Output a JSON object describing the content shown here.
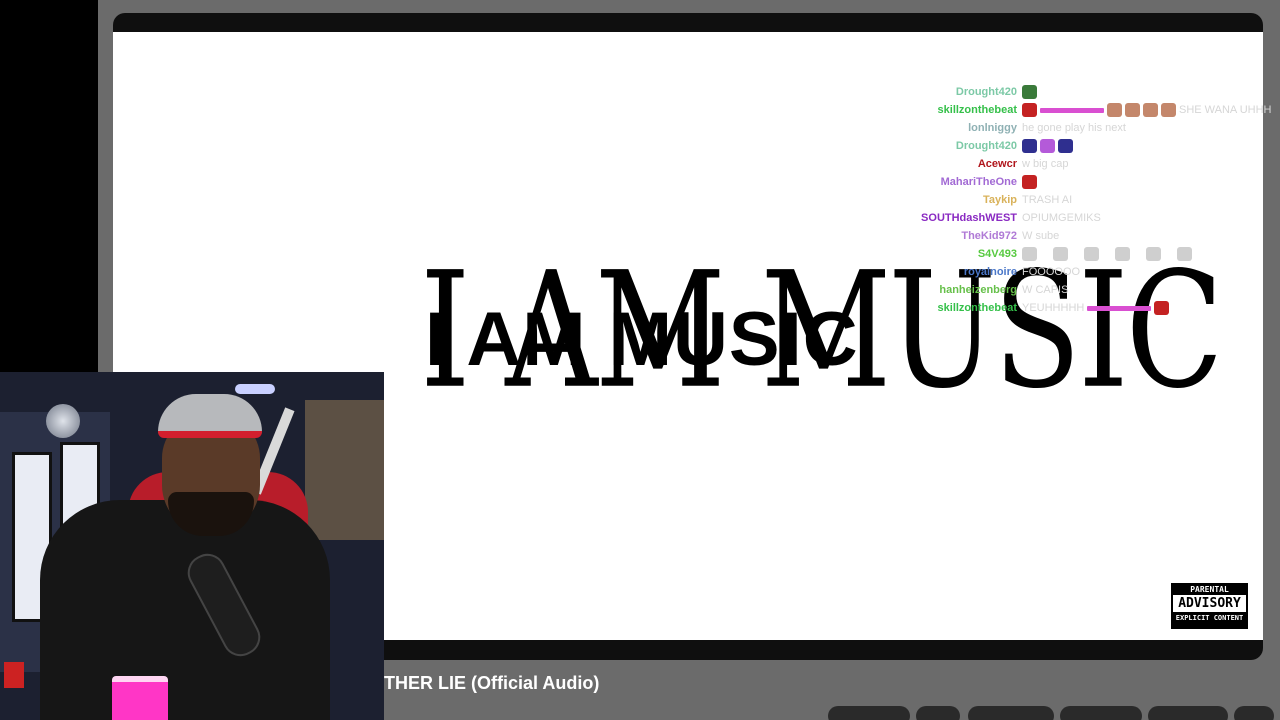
{
  "video": {
    "title_line_serif": "I AM MUSIC",
    "title_line_sans": "I AM MUSIC",
    "title": "THER LIE (Official Audio)"
  },
  "advisory": {
    "top": "PARENTAL",
    "mid": "ADVISORY",
    "bottom": "EXPLICIT CONTENT"
  },
  "chat": {
    "messages": [
      {
        "user": "Drought420",
        "color": "#7cc9a6",
        "text": ""
      },
      {
        "user": "skillzonthebeat",
        "color": "#35c04a",
        "text": "SHE WANA UHHH"
      },
      {
        "user": "lonlniggy",
        "color": "#8fb1b4",
        "text": "he gone play his next"
      },
      {
        "user": "Drought420",
        "color": "#7cc9a6",
        "text": ""
      },
      {
        "user": "Acewcr",
        "color": "#b0161c",
        "text": "w big cap"
      },
      {
        "user": "MahariTheOne",
        "color": "#a26ad4",
        "text": ""
      },
      {
        "user": "Taykip",
        "color": "#d9b25a",
        "text": "TRASH AI"
      },
      {
        "user": "SOUTHdashWEST",
        "color": "#8a2ac2",
        "text": "OPIUMGEMIKS"
      },
      {
        "user": "TheKid972",
        "color": "#b07ad6",
        "text": "W sube"
      },
      {
        "user": "S4V493",
        "color": "#56c93f",
        "text": ""
      },
      {
        "user": "royalnoire",
        "color": "#4a77c9",
        "text": "FOOOOOO"
      },
      {
        "user": "hanheizenberg",
        "color": "#66c04a",
        "text": "W CAPIS"
      },
      {
        "user": "skillzonthebeat",
        "color": "#35c04a",
        "text": "YEUHHHHH"
      }
    ]
  },
  "actions": {
    "like": "",
    "share": "",
    "more": ""
  },
  "colors": {
    "background": "#000000",
    "video_bg": "#ffffff",
    "player_frame": "#0f0f0f"
  }
}
